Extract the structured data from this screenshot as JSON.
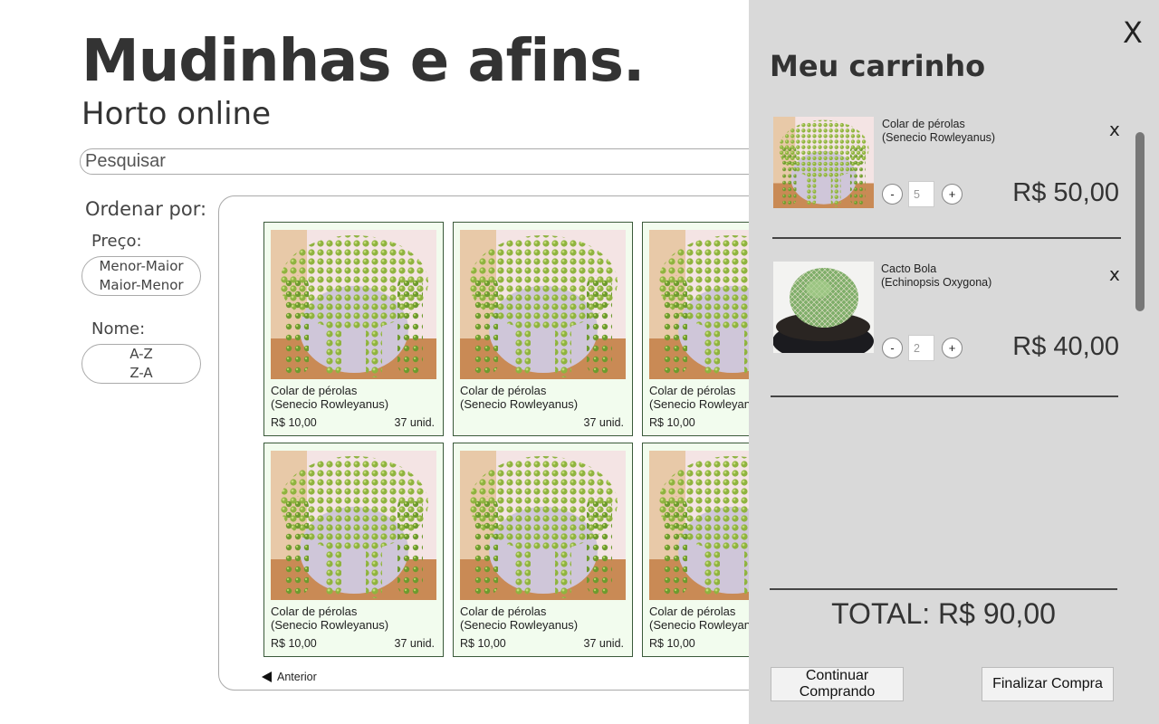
{
  "header": {
    "title": "Mudinhas e afins.",
    "subtitle": "Horto online"
  },
  "search": {
    "placeholder": "Pesquisar",
    "value": ""
  },
  "sort": {
    "title": "Ordenar por:",
    "groups": [
      {
        "label": "Preço:",
        "options": [
          "Menor-Maior",
          "Maior-Menor"
        ]
      },
      {
        "label": "Nome:",
        "options": [
          "A-Z",
          "Z-A"
        ]
      }
    ]
  },
  "products": [
    {
      "name_line1": "Colar de pérolas",
      "name_line2": "(Senecio Rowleyanus)",
      "price": "R$ 10,00",
      "stock": "37 unid.",
      "image": "string-of-pearls"
    },
    {
      "name_line1": "Colar de pérolas",
      "name_line2": "(Senecio Rowleyanus)",
      "price": "",
      "stock": "37 unid.",
      "image": "string-of-pearls"
    },
    {
      "name_line1": "Colar de pérolas",
      "name_line2": "(Senecio Rowleyanus)",
      "price": "R$ 10,00",
      "stock": "",
      "image": "string-of-pearls"
    },
    {
      "name_line1": "Colar de pérolas",
      "name_line2": "(Senecio Rowleyanus)",
      "price": "R$ 10,00",
      "stock": "37 unid.",
      "image": "string-of-pearls"
    },
    {
      "name_line1": "Colar de pérolas",
      "name_line2": "(Senecio Rowleyanus)",
      "price": "R$ 10,00",
      "stock": "37 unid.",
      "image": "string-of-pearls"
    },
    {
      "name_line1": "Colar de pérolas",
      "name_line2": "(Senecio Rowleyanus)",
      "price": "R$ 10,00",
      "stock": "",
      "image": "string-of-pearls"
    }
  ],
  "pagination": {
    "prev_label": "Anterior"
  },
  "cart": {
    "close_label": "X",
    "title": "Meu carrinho",
    "items": [
      {
        "name_line1": "Colar de pérolas",
        "name_line2": "(Senecio Rowleyanus)",
        "quantity": "5",
        "price": "R$ 50,00",
        "remove_label": "x",
        "minus_label": "-",
        "plus_label": "+",
        "image": "string-of-pearls"
      },
      {
        "name_line1": "Cacto Bola",
        "name_line2": "(Echinopsis Oxygona)",
        "quantity": "2",
        "price": "R$ 40,00",
        "remove_label": "x",
        "minus_label": "-",
        "plus_label": "+",
        "image": "ball-cactus"
      }
    ],
    "total": "TOTAL: R$ 90,00",
    "continue_label_line1": "Continuar",
    "continue_label_line2": "Comprando",
    "checkout_label": "Finalizar Compra"
  }
}
